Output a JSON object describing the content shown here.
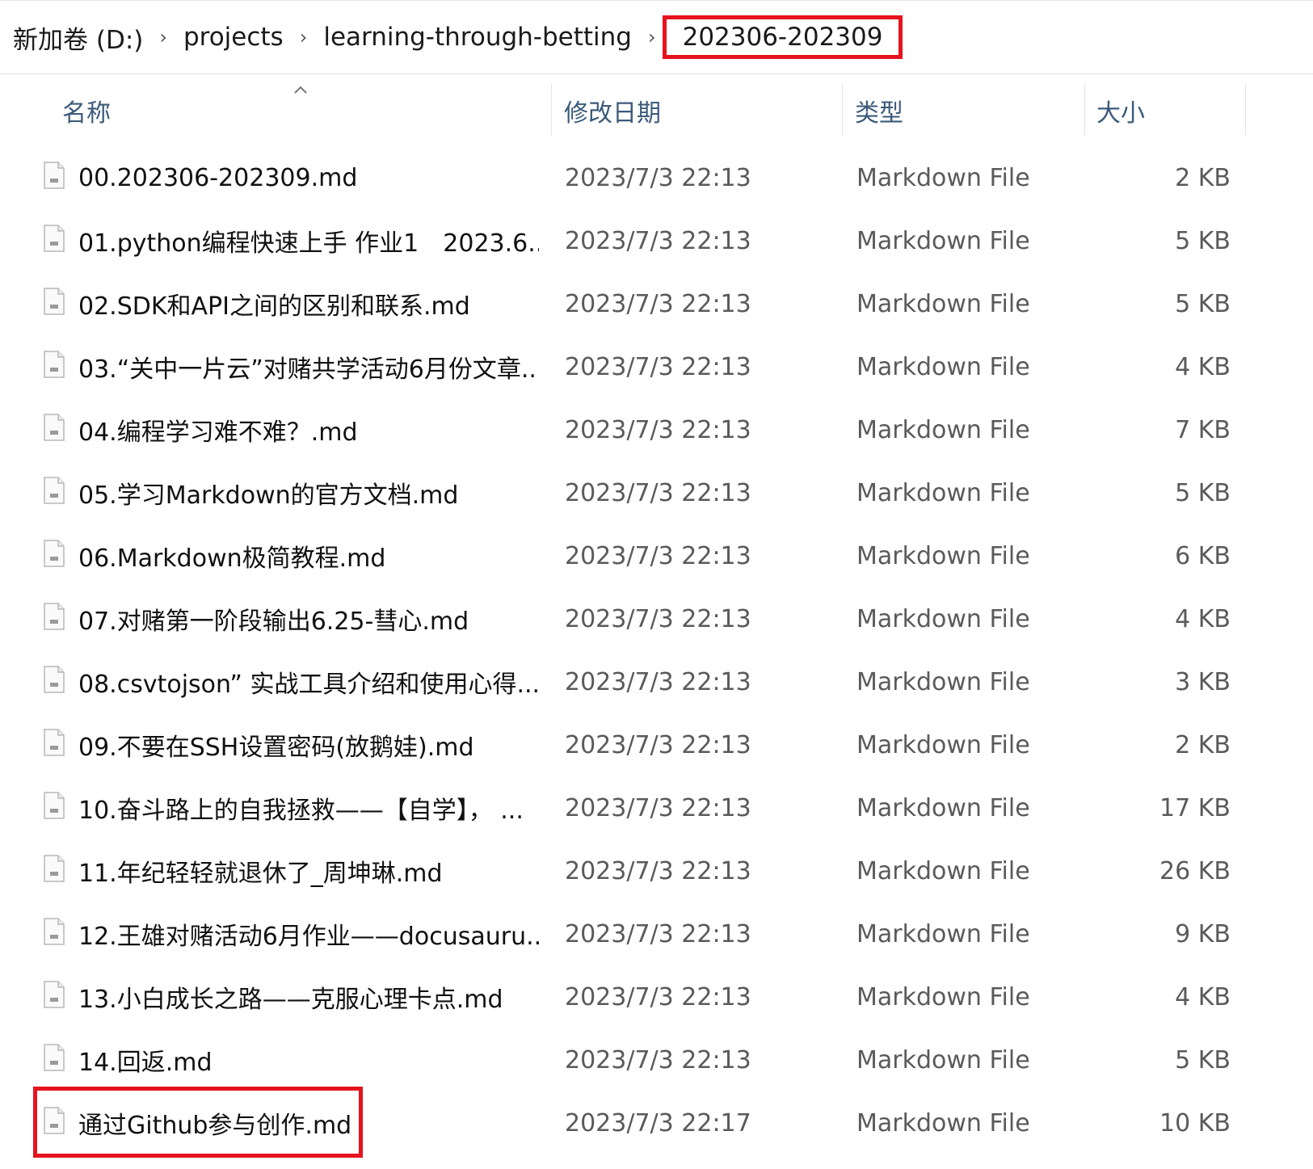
{
  "breadcrumb": {
    "items": [
      "新加卷 (D:)",
      "projects",
      "learning-through-betting"
    ],
    "current": "202306-202309",
    "separator": "›"
  },
  "columns": {
    "name": "名称",
    "date": "修改日期",
    "type": "类型",
    "size": "大小"
  },
  "sort_indicator": "^",
  "files": [
    {
      "name": "00.202306-202309.md",
      "date": "2023/7/3 22:13",
      "type": "Markdown File",
      "size": "2 KB"
    },
    {
      "name": "01.python编程快速上手 作业1　2023.6....",
      "date": "2023/7/3 22:13",
      "type": "Markdown File",
      "size": "5 KB"
    },
    {
      "name": "02.SDK和API之间的区别和联系.md",
      "date": "2023/7/3 22:13",
      "type": "Markdown File",
      "size": "5 KB"
    },
    {
      "name": "03.“关中一片云”对赌共学活动6月份文章....",
      "date": "2023/7/3 22:13",
      "type": "Markdown File",
      "size": "4 KB"
    },
    {
      "name": "04.编程学习难不难？.md",
      "date": "2023/7/3 22:13",
      "type": "Markdown File",
      "size": "7 KB"
    },
    {
      "name": "05.学习Markdown的官方文档.md",
      "date": "2023/7/3 22:13",
      "type": "Markdown File",
      "size": "5 KB"
    },
    {
      "name": "06.Markdown极简教程.md",
      "date": "2023/7/3 22:13",
      "type": "Markdown File",
      "size": "6 KB"
    },
    {
      "name": "07.对赌第一阶段输出6.25-彗心.md",
      "date": "2023/7/3 22:13",
      "type": "Markdown File",
      "size": "4 KB"
    },
    {
      "name": "08.csvtojson” 实战工具介绍和使用心得....",
      "date": "2023/7/3 22:13",
      "type": "Markdown File",
      "size": "3 KB"
    },
    {
      "name": "09.不要在SSH设置密码(放鹅娃).md",
      "date": "2023/7/3 22:13",
      "type": "Markdown File",
      "size": "2 KB"
    },
    {
      "name": "10.奋斗路上的自我拯救——【自学】， ...",
      "date": "2023/7/3 22:13",
      "type": "Markdown File",
      "size": "17 KB"
    },
    {
      "name": "11.年纪轻轻就退休了_周坤琳.md",
      "date": "2023/7/3 22:13",
      "type": "Markdown File",
      "size": "26 KB"
    },
    {
      "name": "12.王雄对赌活动6月作业——docusauru...",
      "date": "2023/7/3 22:13",
      "type": "Markdown File",
      "size": "9 KB"
    },
    {
      "name": "13.小白成长之路——克服心理卡点.md",
      "date": "2023/7/3 22:13",
      "type": "Markdown File",
      "size": "4 KB"
    },
    {
      "name": "14.回返.md",
      "date": "2023/7/3 22:13",
      "type": "Markdown File",
      "size": "5 KB"
    },
    {
      "name": "通过Github参与创作.md",
      "date": "2023/7/3 22:17",
      "type": "Markdown File",
      "size": "10 KB"
    }
  ],
  "icons": {
    "file": "markdown-file-icon",
    "separator": "chevron-right-icon",
    "sort": "sort-ascending-icon"
  },
  "colors": {
    "highlight": "#e5131d",
    "header_text": "#3b5a7a",
    "secondary_text": "#5a5a5a"
  }
}
